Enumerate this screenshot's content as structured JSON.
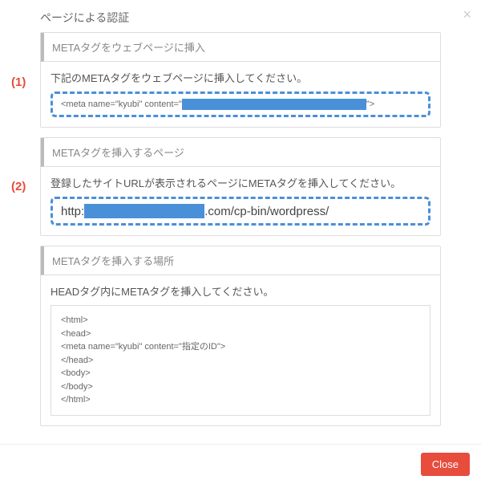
{
  "modal": {
    "title": "ページによる認証",
    "close_x": "×"
  },
  "annotations": {
    "a1": "(1)",
    "a2": "(2)"
  },
  "section1": {
    "header": "METAタグをウェブページに挿入",
    "desc": "下記のMETAタグをウェブページに挿入してください。",
    "meta_prefix": "<meta name=\"kyubi\" content=\"",
    "meta_suffix": "\">"
  },
  "section2": {
    "header": "METAタグを挿入するページ",
    "desc": "登録したサイトURLが表示されるページにMETAタグを挿入してください。",
    "url_prefix": "http:",
    "url_suffix": ".com/cp-bin/wordpress/"
  },
  "section3": {
    "header": "METAタグを挿入する場所",
    "desc": "HEADタグ内にMETAタグを挿入してください。",
    "code": "<html>\n<head>\n<meta name=\"kyubi\" content=\"指定のID\">\n</head>\n<body>\n</body>\n</html>"
  },
  "footer": {
    "close_label": "Close"
  }
}
